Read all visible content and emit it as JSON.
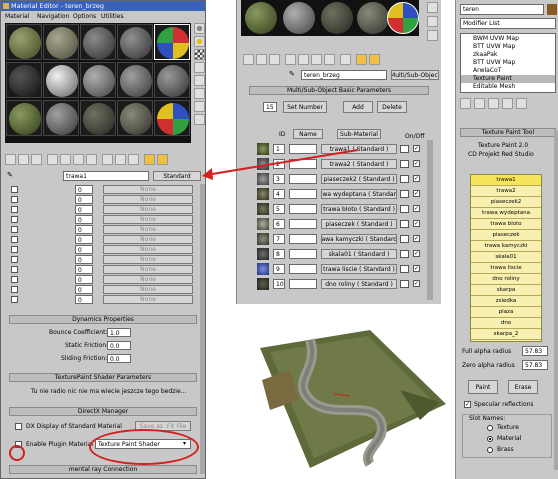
{
  "left_window": {
    "title": "Material Editor - teren_brzeg",
    "menu": [
      "Material",
      "Navigation",
      "Options",
      "Utilities"
    ],
    "material_name": "trawa1",
    "material_type": "Standard",
    "none_label": "None",
    "map_amounts": [
      "0",
      "0",
      "0",
      "0",
      "0",
      "0",
      "0",
      "0",
      "0",
      "0",
      "0",
      "0"
    ],
    "dynamics_header": "Dynamics Properties",
    "bounce_label": "Bounce Coefficient:",
    "bounce_value": "1.0",
    "static_label": "Static Friction:",
    "static_value": "0.0",
    "sliding_label": "Sliding Friction:",
    "sliding_value": "0.0",
    "shader_params_header": "TexturePaint Shader Parameters",
    "shader_params_text": "Tu nie radio nic nie ma wiecie jeszcze tego bedzie...",
    "directx_header": "DirectX Manager",
    "dx_display_label": "DX Display of Standard Material",
    "save_fx_label": "Save as .FX File",
    "enable_plugin_label": "Enable Plugin Material",
    "plugin_select": "Texture Paint Shader",
    "mental_ray_header": "mental ray Connection"
  },
  "multi_sub": {
    "material_name": "teren_brzeg",
    "material_type": "Multi/Sub-Object",
    "params_header": "Multi/Sub-Object Basic Parameters",
    "count": "15",
    "set_number": "Set Number",
    "add": "Add",
    "delete": "Delete",
    "col_id": "ID",
    "col_name": "Name",
    "col_submat": "Sub-Material",
    "col_onoff": "On/Off",
    "rows": [
      {
        "id": "1",
        "mat": "trawa1 ( Standard )"
      },
      {
        "id": "2",
        "mat": "trawa2 ( Standard )"
      },
      {
        "id": "3",
        "mat": "piaseczek2 ( Standard )"
      },
      {
        "id": "4",
        "mat": "trawa wydeptana ( Standard )"
      },
      {
        "id": "5",
        "mat": "trawa bloto ( Standard )"
      },
      {
        "id": "6",
        "mat": "piaseczek ( Standard )"
      },
      {
        "id": "7",
        "mat": "trawa kamyczki ( Standard )"
      },
      {
        "id": "8",
        "mat": "skala01 ( Standard )"
      },
      {
        "id": "9",
        "mat": "trawa liscie ( Standard )"
      },
      {
        "id": "10",
        "mat": "dno roliny ( Standard )"
      }
    ]
  },
  "modifier_panel": {
    "object_name": "teren",
    "modifier_list": "Modifier List",
    "stack": [
      "BWM UVW Map",
      "BTT UVW Map",
      "zkaaPak",
      "BTT UVW Map",
      "ArwlaCoT",
      "Texture Paint",
      "Editable Mesh"
    ]
  },
  "texture_tool": {
    "header": "Texture Paint Tool",
    "version": "Texture Paint 2.0",
    "studio": "CD Projekt Red Studio",
    "slots": [
      "trawa1",
      "trawa2",
      "piaseczek2",
      "trawa wydeptana",
      "trawa bloto",
      "piaseczek",
      "trawa kamyczki",
      "skala01",
      "trawa liscie",
      "dno roliny",
      "skarpa",
      "zsiedka",
      "plaza",
      "dno",
      "skarpa_2"
    ],
    "full_alpha_label": "Full alpha radius",
    "full_alpha_value": "57.83",
    "zero_alpha_label": "Zero alpha radius",
    "zero_alpha_value": "57.83",
    "paint": "Paint",
    "erase": "Erase",
    "specular_label": "Specular reflections",
    "slot_names_label": "Slot Names:",
    "radio_texture": "Texture",
    "radio_material": "Material",
    "radio_brass": "Brass"
  },
  "colors": {
    "annotation_red": "#d42020",
    "slot_selected_yellow": "#f6e45a",
    "slot_yellow": "#f8f0b0",
    "max_grey": "#c8c8c8"
  }
}
